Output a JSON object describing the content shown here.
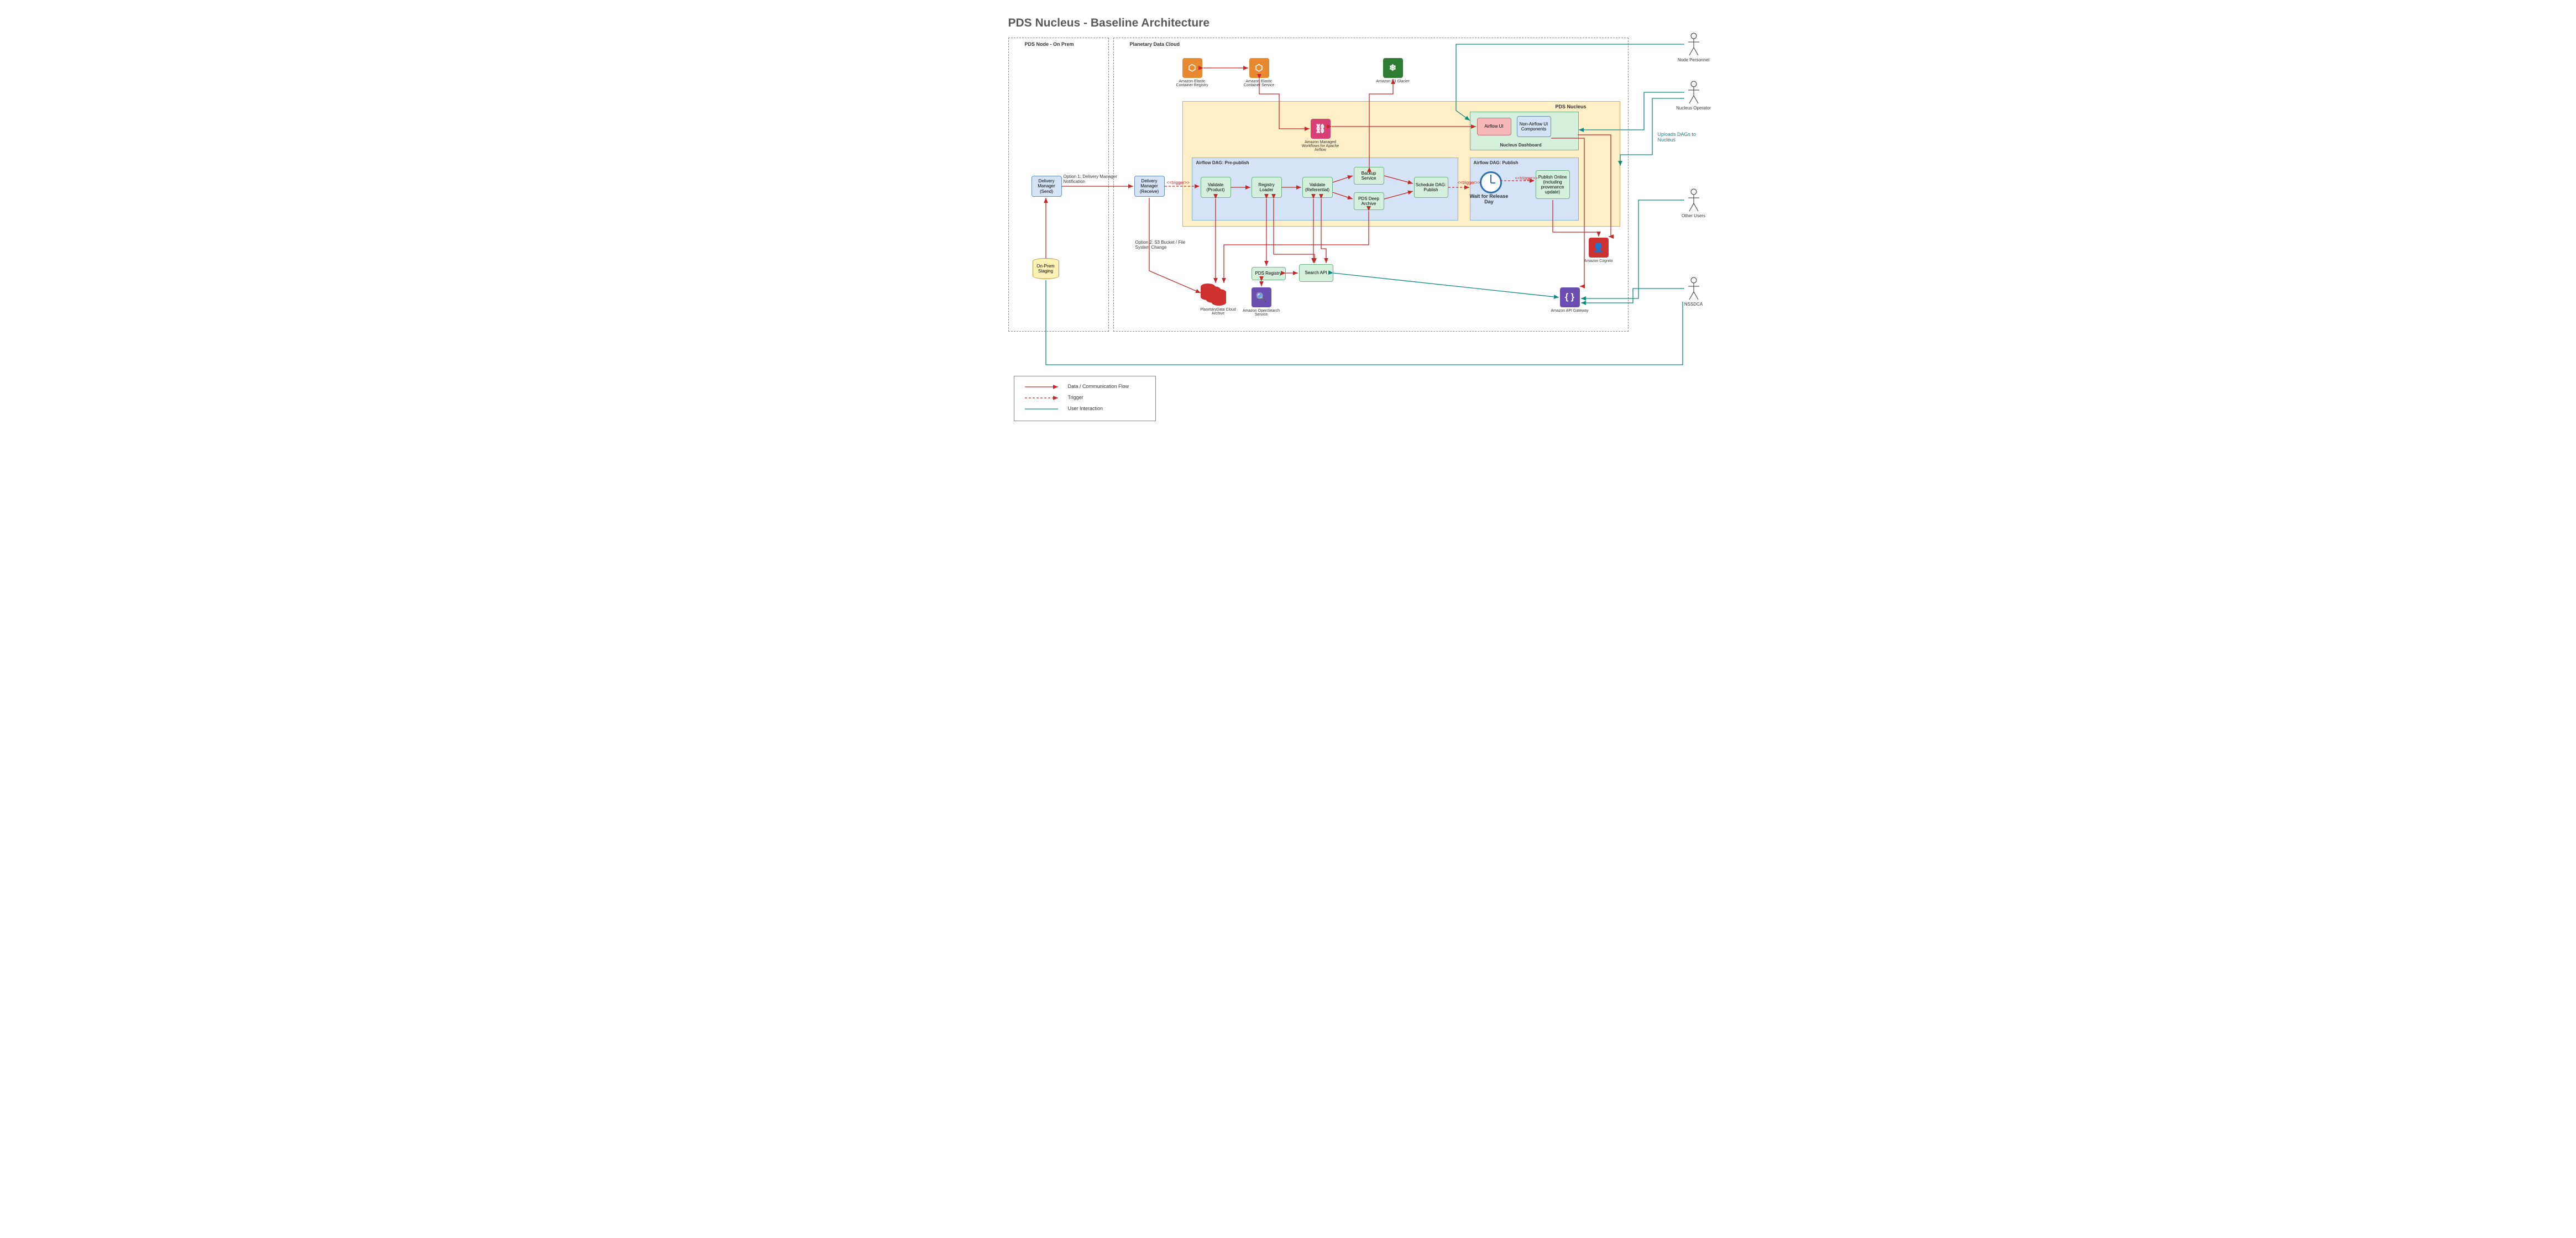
{
  "title": "PDS Nucleus - Baseline Architecture",
  "containers": {
    "on_prem": "PDS Node - On Prem",
    "cloud": "Planetary Data Cloud",
    "nucleus": "PDS Nucleus",
    "dag_pre": "Airflow DAG: Pre-publish",
    "dag_pub": "Airflow DAG: Publish",
    "dashboard": "Nucleus Dashboard"
  },
  "nodes": {
    "dm_send": "Delivery Manager (Send)",
    "dm_recv": "Delivery Manager (Receive)",
    "on_prem_staging": "On-Prem Staging",
    "validate_product": "Validate (Product)",
    "registry_loader": "Registry Loader",
    "validate_ref": "Validate (Referential)",
    "backup_service": "Backup Service",
    "deep_archive": "PDS Deep Archive",
    "schedule_dag": "Schedule DAG: Publish",
    "wait_release": "Wait for Release Day",
    "publish_online": "Publish Online (including provenance update)",
    "airflow_ui": "Airflow UI",
    "non_airflow_ui": "Non-Airflow UI Components",
    "pds_registry": "PDS Registry",
    "search_api": "Search API",
    "pd_cloud_archive": "PlanetaryData Cloud Archive"
  },
  "aws": {
    "ecr": "Amazon Elastic Container Registry",
    "ecs": "Amazon Elastic Container Service",
    "glacier": "Amazon S3 Glacier",
    "mwaa": "Amazon Managed Workflows for Apache Airflow",
    "opensearch": "Amazon OpenSearch Service",
    "cognito": "Amazon Cognito",
    "apigw": "Amazon API Gateway"
  },
  "actors": {
    "node_personnel": "Node Personnel",
    "nucleus_operator": "Nucleus Operator",
    "other_users": "Other Users",
    "nssdca": "NSSDCA"
  },
  "edge_labels": {
    "option1": "Option 1: Delivery Manager Notification",
    "option2": "Option 2: S3 Bucket / File System Change",
    "trigger": "<<trigger>>",
    "uploads_dags": "Uploads DAGs to Nucleus"
  },
  "legend": {
    "data_flow": "Data / Communication Flow",
    "trigger": "Trigger",
    "user_interaction": "User Interaction"
  },
  "colors": {
    "data_flow": "#c62828",
    "trigger": "#c62828",
    "user_interaction": "#0b8a7f",
    "aws_orange": "#e8892f",
    "aws_red": "#cf3030",
    "aws_green": "#2e7d32",
    "aws_pink": "#d84076",
    "aws_purple": "#6a4fb0",
    "nucleus_bg": "#ffefc7",
    "dag_bg": "#d4e4f6",
    "node_green": "#d4f0dd"
  }
}
